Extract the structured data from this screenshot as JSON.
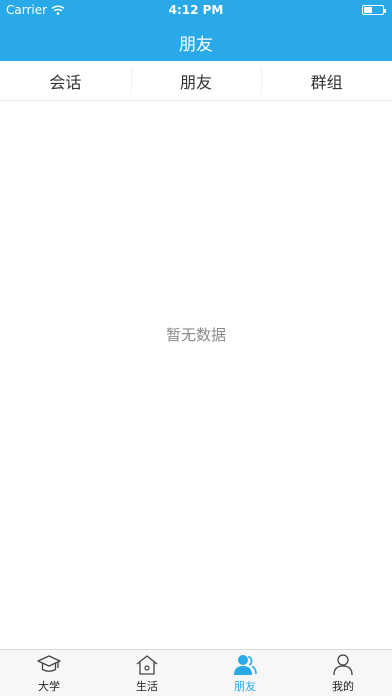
{
  "status_bar": {
    "carrier": "Carrier",
    "time": "4:12 PM",
    "battery_level": 0.4
  },
  "header": {
    "title": "朋友"
  },
  "tabs": [
    {
      "label": "会话",
      "active": true
    },
    {
      "label": "朋友",
      "active": false
    },
    {
      "label": "群组",
      "active": false
    }
  ],
  "content": {
    "empty_text": "暂无数据"
  },
  "tabbar": {
    "items": [
      {
        "label": "大学",
        "icon": "graduation-cap-icon",
        "active": false
      },
      {
        "label": "生活",
        "icon": "house-icon",
        "active": false
      },
      {
        "label": "朋友",
        "icon": "friends-icon",
        "active": true
      },
      {
        "label": "我的",
        "icon": "person-icon",
        "active": false
      }
    ]
  },
  "colors": {
    "accent": "#2aa9e8",
    "text": "#333333",
    "muted": "#8a8a8a"
  }
}
